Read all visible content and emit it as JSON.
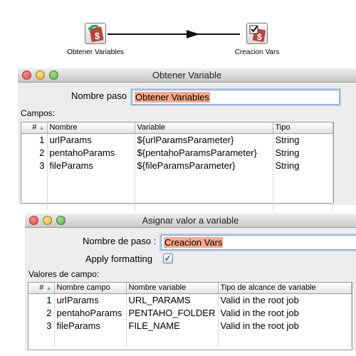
{
  "canvas": {
    "steps": [
      {
        "label": "Obtener Variables",
        "icon": "get-variables-icon"
      },
      {
        "label": "Creacion Vars",
        "icon": "set-variables-icon"
      }
    ]
  },
  "dialog_get": {
    "title": "Obtener Variable",
    "step_name_label": "Nombre paso",
    "step_name_value": "Obtener Variables",
    "fields_label": "Campos:",
    "columns": [
      "#",
      "Nombre",
      "Variable",
      "Tipo"
    ],
    "rows": [
      {
        "num": "1",
        "name": "urlParams",
        "variable": "${urlParamsParameter}",
        "type": "String"
      },
      {
        "num": "2",
        "name": "pentahoParams",
        "variable": "${pentahoParamsParameter}",
        "type": "String"
      },
      {
        "num": "3",
        "name": "fileParams",
        "variable": "${fileParamsParameter}",
        "type": "String"
      }
    ]
  },
  "dialog_set": {
    "title": "Asignar valor a variable",
    "step_name_label": "Nombre de paso :",
    "step_name_value": "Creacion Vars",
    "apply_formatting_label": "Apply formatting",
    "apply_formatting_checked": true,
    "fields_label": "Valores de campo:",
    "columns": [
      "#",
      "Nombre campo",
      "Nombre variable",
      "Tipo de alcance de variable"
    ],
    "rows": [
      {
        "num": "1",
        "field": "urlParams",
        "variable": "URL_PARAMS",
        "scope": "Valid in the root job"
      },
      {
        "num": "2",
        "field": "pentahoParams",
        "variable": "PENTAHO_FOLDER",
        "scope": "Valid in the root job"
      },
      {
        "num": "3",
        "field": "fileParams",
        "variable": "FILE_NAME",
        "scope": "Valid in the root job"
      }
    ]
  },
  "colors": {
    "highlight": "#f7a98a",
    "focus_ring": "#b3cdeb"
  }
}
